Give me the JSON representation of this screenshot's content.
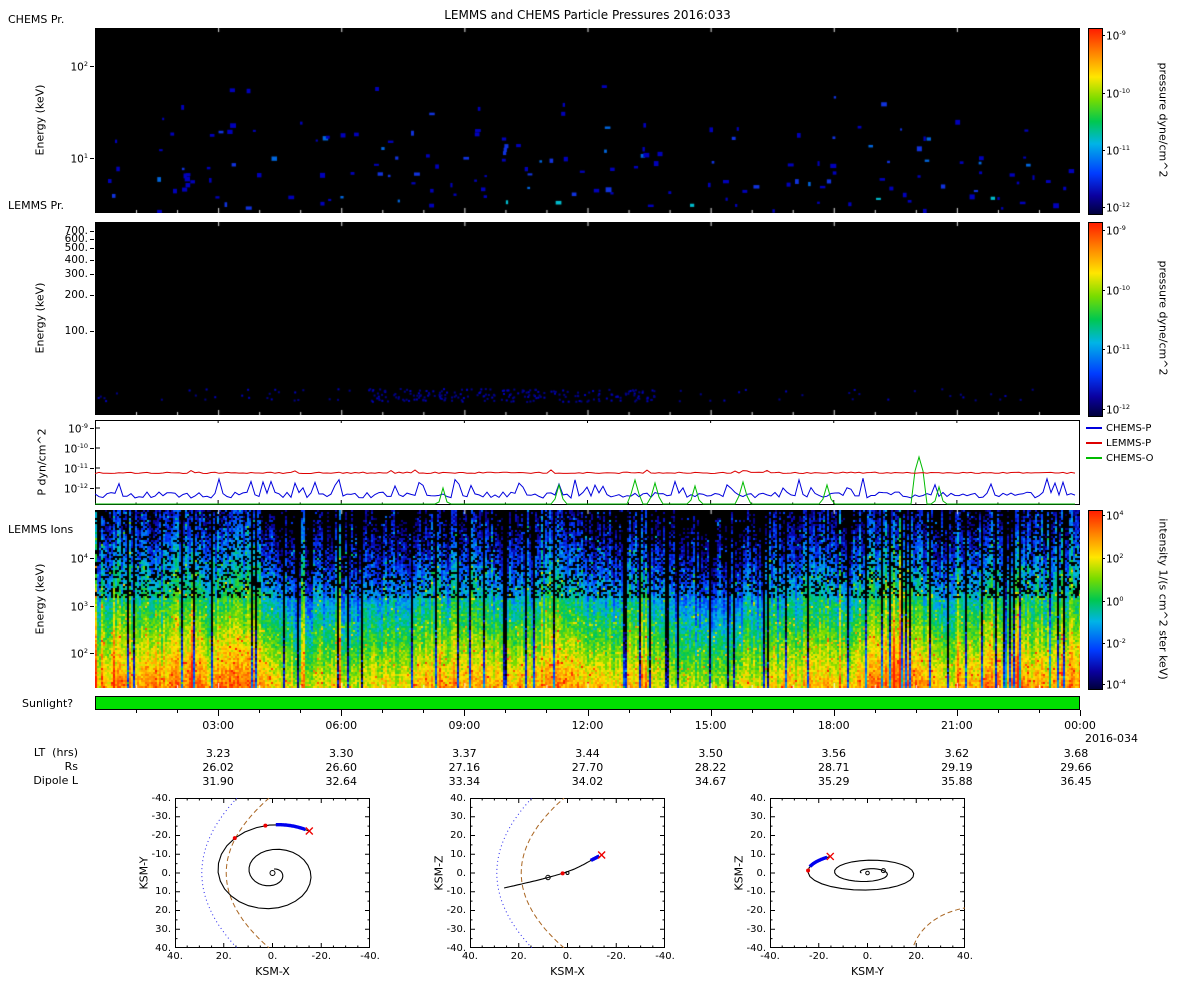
{
  "title": "LEMMS and CHEMS Particle Pressures  2016:033",
  "time_axis": {
    "ticks": [
      "03:00",
      "06:00",
      "09:00",
      "12:00",
      "15:00",
      "18:00",
      "21:00",
      "00:00"
    ],
    "end_date_label": "2016-034"
  },
  "ephemeris": {
    "rows": [
      {
        "label": "LT  (hrs)",
        "values": [
          "3.23",
          "3.30",
          "3.37",
          "3.44",
          "3.50",
          "3.56",
          "3.62",
          "3.68"
        ]
      },
      {
        "label": "Rs",
        "values": [
          "26.02",
          "26.60",
          "27.16",
          "27.70",
          "28.22",
          "28.71",
          "29.19",
          "29.66"
        ]
      },
      {
        "label": "Dipole L",
        "values": [
          "31.90",
          "32.64",
          "33.34",
          "34.02",
          "34.67",
          "35.29",
          "35.88",
          "36.45"
        ]
      }
    ]
  },
  "colorbars": {
    "pressure": {
      "label": "pressure dyne/cm^2",
      "ticks": [
        {
          "label": "10^-9",
          "frac": 0.04
        },
        {
          "label": "10^-10",
          "frac": 0.35
        },
        {
          "label": "10^-11",
          "frac": 0.66
        },
        {
          "label": "10^-12",
          "frac": 0.97
        }
      ]
    },
    "intensity": {
      "label": "intensity 1/(s cm^2 ster keV)",
      "ticks": [
        {
          "label": "10^4",
          "frac": 0.03
        },
        {
          "label": "10^2",
          "frac": 0.27
        },
        {
          "label": "10^0",
          "frac": 0.51
        },
        {
          "label": "10^-2",
          "frac": 0.745
        },
        {
          "label": "10^-4",
          "frac": 0.975
        }
      ]
    }
  },
  "chart_data": [
    {
      "id": "chems_pressure_spectrogram",
      "type": "heatmap",
      "corner_label": "CHEMS Pr.",
      "ylabel": "Energy (keV)",
      "yscale": "log",
      "yrange_keV": [
        3,
        270
      ],
      "ytick_marks": [
        {
          "label": "10^2",
          "off": 38
        },
        {
          "label": "10^1",
          "off": 130
        }
      ],
      "zlabel": "pressure dyne/cm^2",
      "zrange": [
        1e-12,
        1e-09
      ],
      "x_range": "2016-033 00:00 to 2016-034 00:00",
      "content": "mostly empty (black); sparse faint blue/cyan pixels at 3-20 keV scattered across the whole day, a few teal pixels at lowest energies",
      "speckle_count": 170,
      "seed": 11
    },
    {
      "id": "lemms_pressure_spectrogram",
      "type": "heatmap",
      "corner_label": "LEMMS Pr.",
      "ylabel": "Energy (keV)",
      "yscale": "log",
      "yrange_keV": [
        20,
        830
      ],
      "ytick_marks": [
        {
          "label": "700.",
          "off": 9
        },
        {
          "label": "600.",
          "off": 17
        },
        {
          "label": "500.",
          "off": 26
        },
        {
          "label": "400.",
          "off": 38
        },
        {
          "label": "300.",
          "off": 52
        },
        {
          "label": "200.",
          "off": 73
        },
        {
          "label": "100.",
          "off": 109
        }
      ],
      "zlabel": "pressure dyne/cm^2",
      "zrange": [
        1e-12,
        1e-09
      ],
      "content": "almost entirely black; very faint dark-blue pixel band near the lowest energies (~25-35 keV), concentrated between ~06:00 and ~13:00",
      "speckle_count": 260,
      "seed": 23
    },
    {
      "id": "pressure_timeseries",
      "type": "line",
      "ylabel": "P dyn/cm^2",
      "yscale": "log",
      "yrange": [
        1e-13,
        1e-09
      ],
      "ytick_marks": [
        {
          "label": "10^-9",
          "off": 8
        },
        {
          "label": "10^-10",
          "off": 28
        },
        {
          "label": "10^-11",
          "off": 48
        },
        {
          "label": "10^-12",
          "off": 68
        }
      ],
      "series": [
        {
          "name": "CHEMS-P",
          "color": "#0000dd",
          "level_log10": -12.35,
          "behavior": "noisy, frequent upward spikes to ~1e-11.5"
        },
        {
          "name": "LEMMS-P",
          "color": "#dd0000",
          "level_log10": -11.24,
          "behavior": "nearly constant just above 1e-11.3"
        },
        {
          "name": "CHEMS-O",
          "color": "#00bb00",
          "level_log10": -13.2,
          "behavior": "below scale except isolated spikes",
          "spikes_frac_log10": [
            [
              0.355,
              -12.0
            ],
            [
              0.472,
              -11.85
            ],
            [
              0.553,
              -11.6
            ],
            [
              0.573,
              -11.75
            ],
            [
              0.614,
              -11.9
            ],
            [
              0.66,
              -11.7
            ],
            [
              0.746,
              -11.85
            ],
            [
              0.842,
              -10.45
            ],
            [
              0.862,
              -11.95
            ]
          ]
        }
      ],
      "seed": 5
    },
    {
      "id": "lemms_ions_spectrogram",
      "type": "heatmap",
      "corner_label": "LEMMS Ions",
      "ylabel": "Energy (keV)",
      "yscale": "log",
      "yrange_keV": [
        20,
        112000
      ],
      "ytick_marks": [
        {
          "label": "10^4",
          "off": 48
        },
        {
          "label": "10^3",
          "off": 96
        },
        {
          "label": "10^2",
          "off": 143
        }
      ],
      "zlabel": "intensity 1/(s cm^2 ster keV)",
      "zrange": [
        1e-05,
        10000.0
      ],
      "content": "dense noisy spectrogram with strong vertical striping: bright yellow-orange at lowest energies, green-cyan mid energies, blue/black speckle at high energies, occasional black dropout columns",
      "seed": 37
    },
    {
      "id": "sunlight_bar",
      "type": "bar",
      "label": "Sunlight?",
      "state": "on for entire interval",
      "color": "#00e000"
    },
    {
      "id": "orbit_xy",
      "type": "scatter",
      "xlabel": "KSM-X",
      "ylabel": "KSM-Y",
      "xlim": [
        40,
        -40
      ],
      "ylim": [
        -40,
        40
      ],
      "xtick_labels": [
        "40.",
        "20.",
        "0.",
        "-20.",
        "-40."
      ],
      "ytick_labels": [
        "-40.",
        "-30.",
        "-20.",
        "-10.",
        "0.",
        "10.",
        "20.",
        "30.",
        "40."
      ],
      "boundaries": [
        {
          "name": "bow-shock",
          "color": "#2222ee",
          "style": "dotted",
          "shape": "parabola",
          "x0": 29,
          "k": 0.009
        },
        {
          "name": "magnetopause",
          "color": "#aa6622",
          "style": "dashed",
          "shape": "parabola",
          "x0": 19,
          "k": 0.011
        }
      ],
      "trajectory": {
        "kind": "spiral",
        "r0": 2.2,
        "r1": 27,
        "pow": 1.15,
        "theta_end_deg": 236,
        "turns": 2.05,
        "squash": 1
      },
      "segment_today": {
        "s0": 0.958,
        "s1": 0.995,
        "color": "#0000ee"
      },
      "markers": [
        {
          "type": "dot",
          "s": 0.9,
          "color": "#ee0000"
        },
        {
          "type": "dot",
          "s": 0.945,
          "color": "#ee0000"
        },
        {
          "type": "x",
          "s": 1,
          "color": "#ee0000"
        },
        {
          "type": "circle",
          "u": 0,
          "v": 0,
          "r": 2.5
        }
      ]
    },
    {
      "id": "orbit_xz",
      "type": "scatter",
      "xlabel": "KSM-X",
      "ylabel": "KSM-Z",
      "xlim": [
        40,
        -40
      ],
      "ylim": [
        40,
        -40
      ],
      "xtick_labels": [
        "40.",
        "20.",
        "0.",
        "-20.",
        "-40."
      ],
      "ytick_labels": [
        "40.",
        "30.",
        "20.",
        "10.",
        "0.",
        "-10.",
        "-20.",
        "-30.",
        "-40."
      ],
      "boundaries": [
        {
          "name": "bow-shock",
          "color": "#2222ee",
          "style": "dotted",
          "shape": "parabola",
          "x0": 29,
          "k": 0.009
        },
        {
          "name": "magnetopause",
          "color": "#aa6622",
          "style": "dashed",
          "shape": "parabola",
          "x0": 19,
          "k": 0.011
        }
      ],
      "trajectory": {
        "kind": "poly",
        "pts": [
          [
            26,
            -8
          ],
          [
            20,
            -6.2
          ],
          [
            14,
            -4.4
          ],
          [
            8,
            -2.4
          ],
          [
            2,
            -0.2
          ],
          [
            -3,
            2.2
          ],
          [
            -7,
            4.8
          ],
          [
            -10,
            7
          ],
          [
            -13,
            9
          ]
        ]
      },
      "segment_today": {
        "s0": 0.86,
        "s1": 1.0,
        "color": "#0000ee"
      },
      "markers": [
        {
          "type": "circle",
          "s": 0.375,
          "r": 2.2
        },
        {
          "type": "dot",
          "s": 0.5,
          "color": "#ee0000"
        },
        {
          "type": "x",
          "u": -14,
          "v": 9.6,
          "color": "#ee0000"
        },
        {
          "type": "circle",
          "u": 0,
          "v": 0,
          "r": 1.5
        }
      ]
    },
    {
      "id": "orbit_yz",
      "type": "scatter",
      "xlabel": "KSM-Y",
      "ylabel": "KSM-Z",
      "xlim": [
        -40,
        40
      ],
      "ylim": [
        40,
        -40
      ],
      "xtick_labels": [
        "-40.",
        "-20.",
        "0.",
        "20.",
        "40."
      ],
      "ytick_labels": [
        "40.",
        "30.",
        "20.",
        "10.",
        "0.",
        "-10.",
        "-20.",
        "-30.",
        "-40."
      ],
      "boundaries": [
        {
          "name": "magnetopause",
          "color": "#aa6622",
          "style": "dashed",
          "shape": "arc",
          "cx": 46,
          "cy": -46,
          "r": 28,
          "a0": 100,
          "a1": 170
        }
      ],
      "trajectory": {
        "kind": "spiral",
        "r0": 2.5,
        "r1": 26,
        "pow": 1,
        "theta_end_deg": 126,
        "turns": 2.15,
        "squash": 0.42
      },
      "segment_today": {
        "s0": 0.955,
        "s1": 0.995,
        "color": "#0000ee"
      },
      "markers": [
        {
          "type": "dot",
          "s": 0.94,
          "color": "#ee0000"
        },
        {
          "type": "x",
          "s": 1,
          "color": "#ee0000"
        },
        {
          "type": "circle",
          "u": 0,
          "v": 0,
          "r": 1.8
        },
        {
          "type": "circle",
          "s": 0.2,
          "r": 2
        }
      ]
    }
  ]
}
